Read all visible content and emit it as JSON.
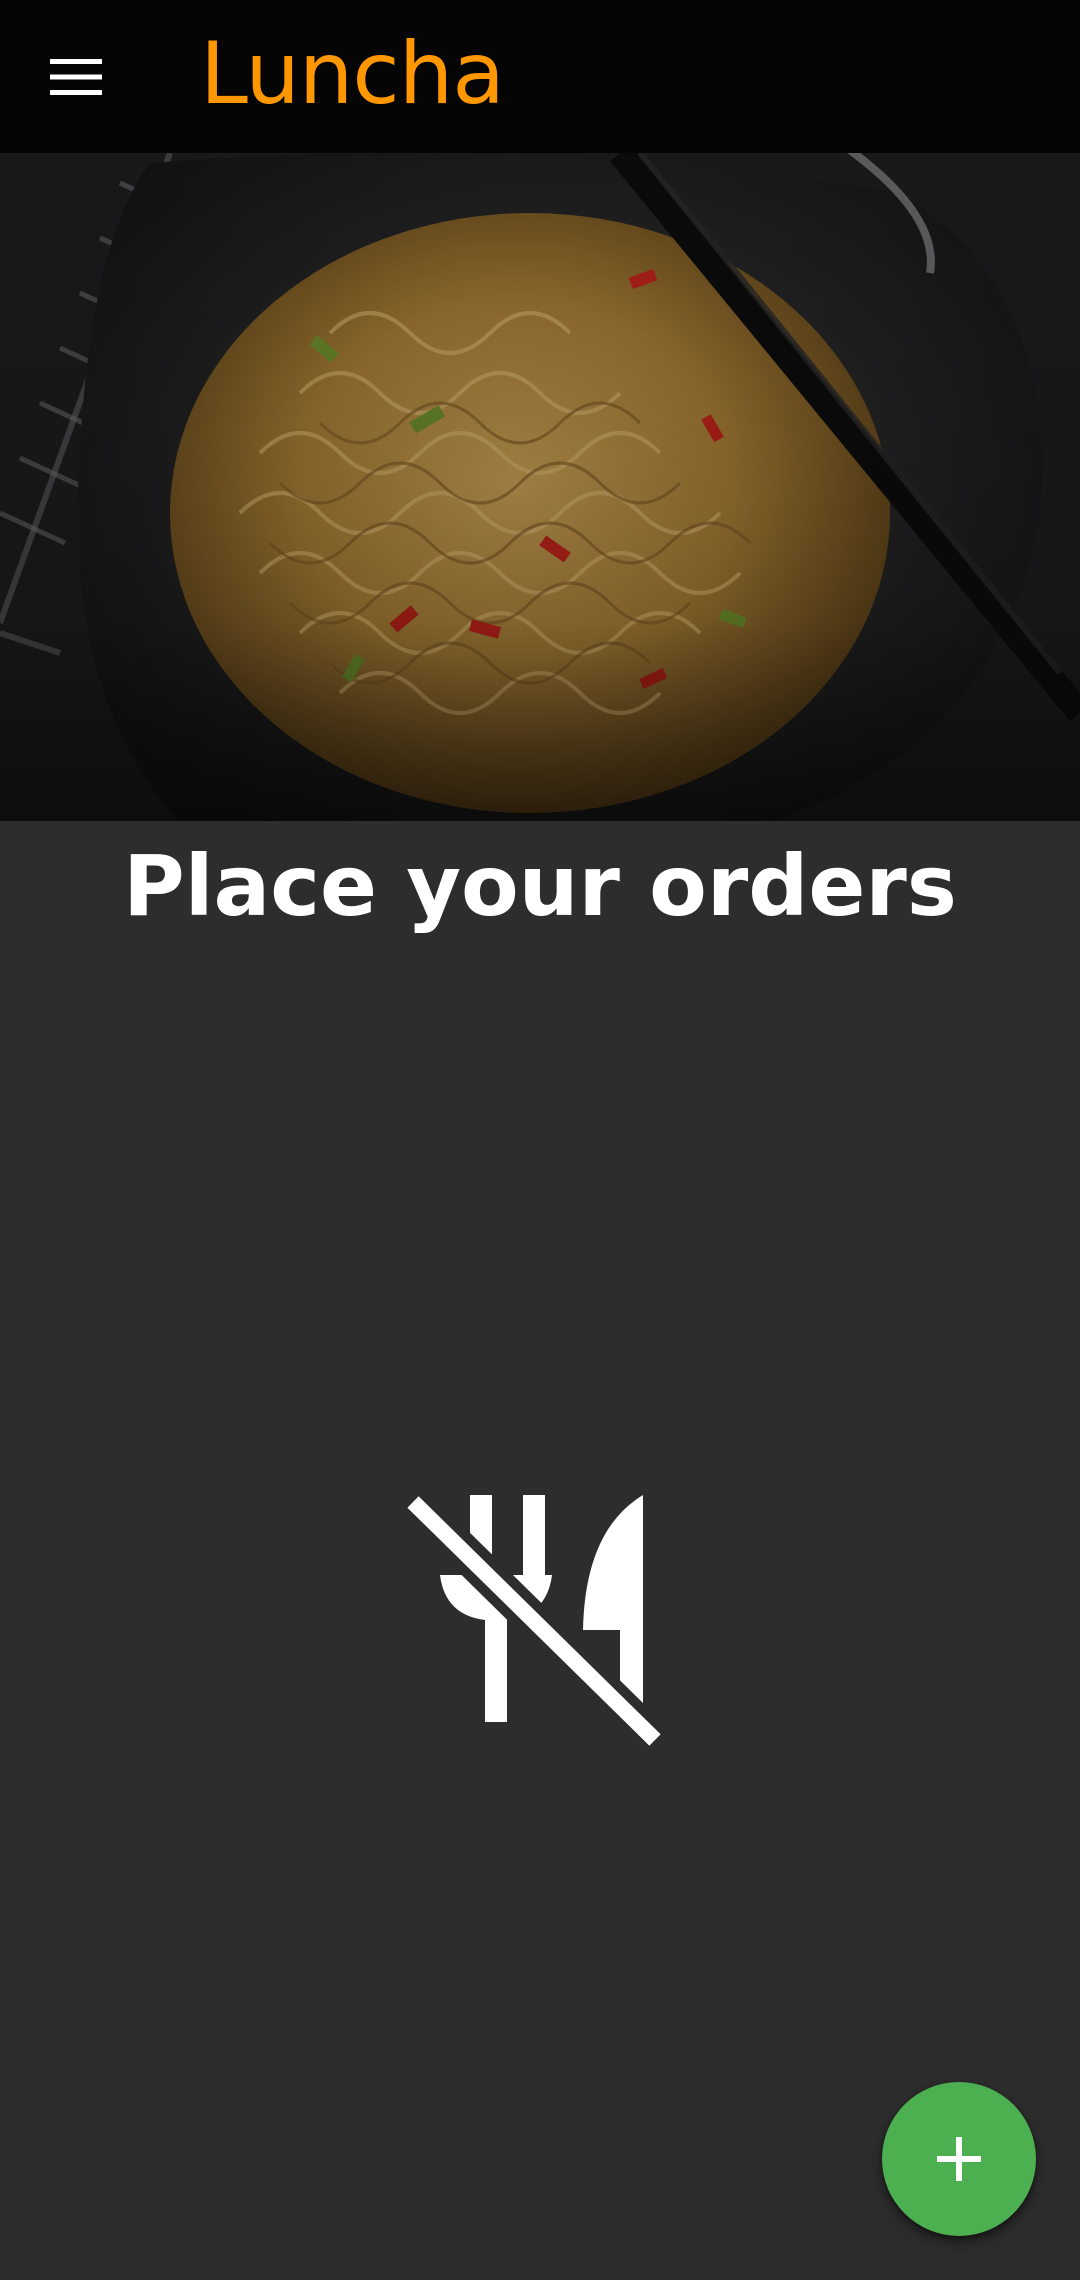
{
  "app_bar": {
    "title": "Luncha",
    "menu_icon": "menu-icon",
    "background": "#050505",
    "title_color": "#ff9800"
  },
  "hero": {
    "image": "noodles-in-black-bowl-with-chopsticks"
  },
  "main": {
    "heading": "Place your orders",
    "empty_state_icon": "no-meals-icon"
  },
  "fab": {
    "icon": "add-icon",
    "color": "#4caf50"
  },
  "colors": {
    "background": "#2e2d2e",
    "text": "#ffffff"
  }
}
